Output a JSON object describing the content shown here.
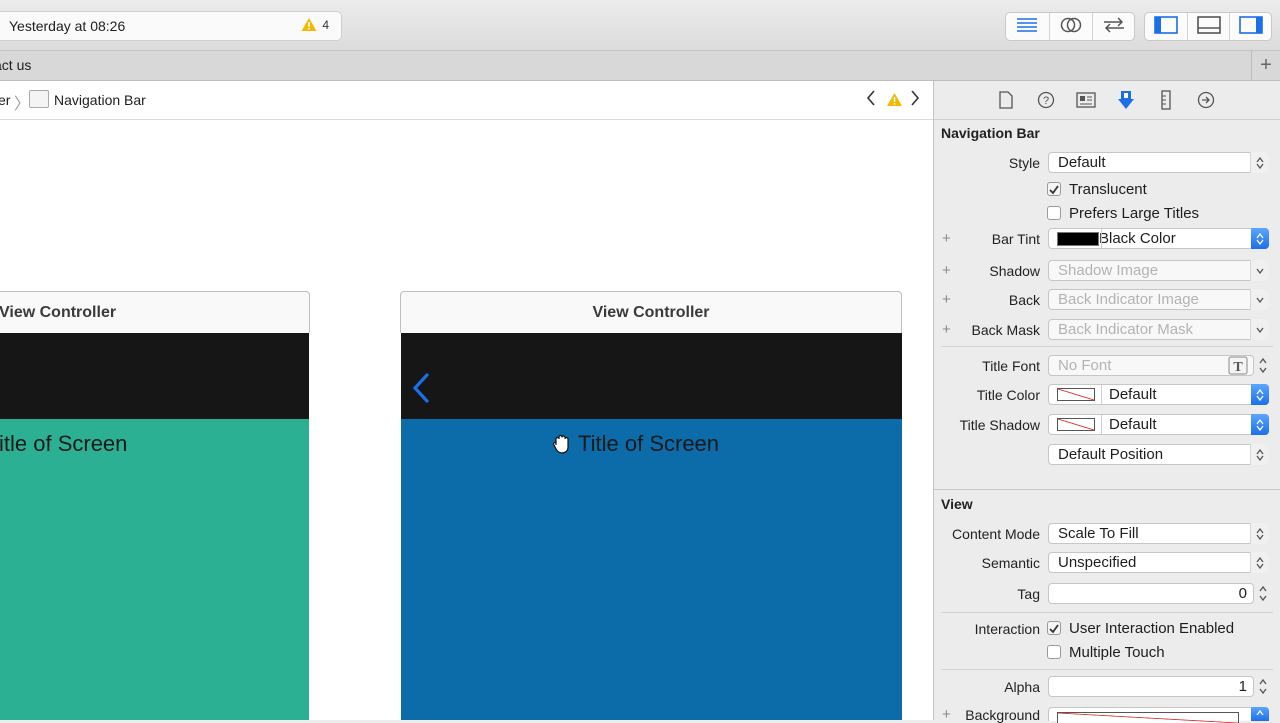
{
  "toolbar": {
    "activity_text": "Yesterday at 08:26",
    "warning_count": "4"
  },
  "tabbar": {
    "tab_label": "act us",
    "add_label": "+"
  },
  "jumpbar": {
    "prev_crumb": "er",
    "current": "Navigation Bar"
  },
  "canvas": {
    "left_scene": {
      "title": "View Controller",
      "screen_title": "itle of Screen",
      "content_color": "#2bb093"
    },
    "right_scene": {
      "title": "View Controller",
      "screen_title": "Title of Screen",
      "content_color": "#0c6ba9",
      "back_chevron": "‹"
    }
  },
  "inspector": {
    "navbar_section": "Navigation Bar",
    "style_label": "Style",
    "style_value": "Default",
    "translucent_label": "Translucent",
    "translucent_checked": true,
    "large_titles_label": "Prefers Large Titles",
    "large_titles_checked": false,
    "bar_tint_label": "Bar Tint",
    "bar_tint_value": "Black Color",
    "shadow_label": "Shadow",
    "shadow_placeholder": "Shadow Image",
    "back_label": "Back",
    "back_placeholder": "Back Indicator Image",
    "back_mask_label": "Back Mask",
    "back_mask_placeholder": "Back Indicator Mask",
    "title_font_label": "Title Font",
    "title_font_placeholder": "No Font",
    "title_color_label": "Title Color",
    "title_color_value": "Default",
    "title_shadow_label": "Title Shadow",
    "title_shadow_value": "Default",
    "position_value": "Default Position",
    "view_section": "View",
    "content_mode_label": "Content Mode",
    "content_mode_value": "Scale To Fill",
    "semantic_label": "Semantic",
    "semantic_value": "Unspecified",
    "tag_label": "Tag",
    "tag_value": "0",
    "interaction_label": "Interaction",
    "user_interaction_label": "User Interaction Enabled",
    "user_interaction_checked": true,
    "multiple_touch_label": "Multiple Touch",
    "multiple_touch_checked": false,
    "alpha_label": "Alpha",
    "alpha_value": "1",
    "background_label": "Background"
  },
  "colors": {
    "accent": "#1c6fe8",
    "warning": "#f5b800",
    "navbar": "#161616"
  }
}
